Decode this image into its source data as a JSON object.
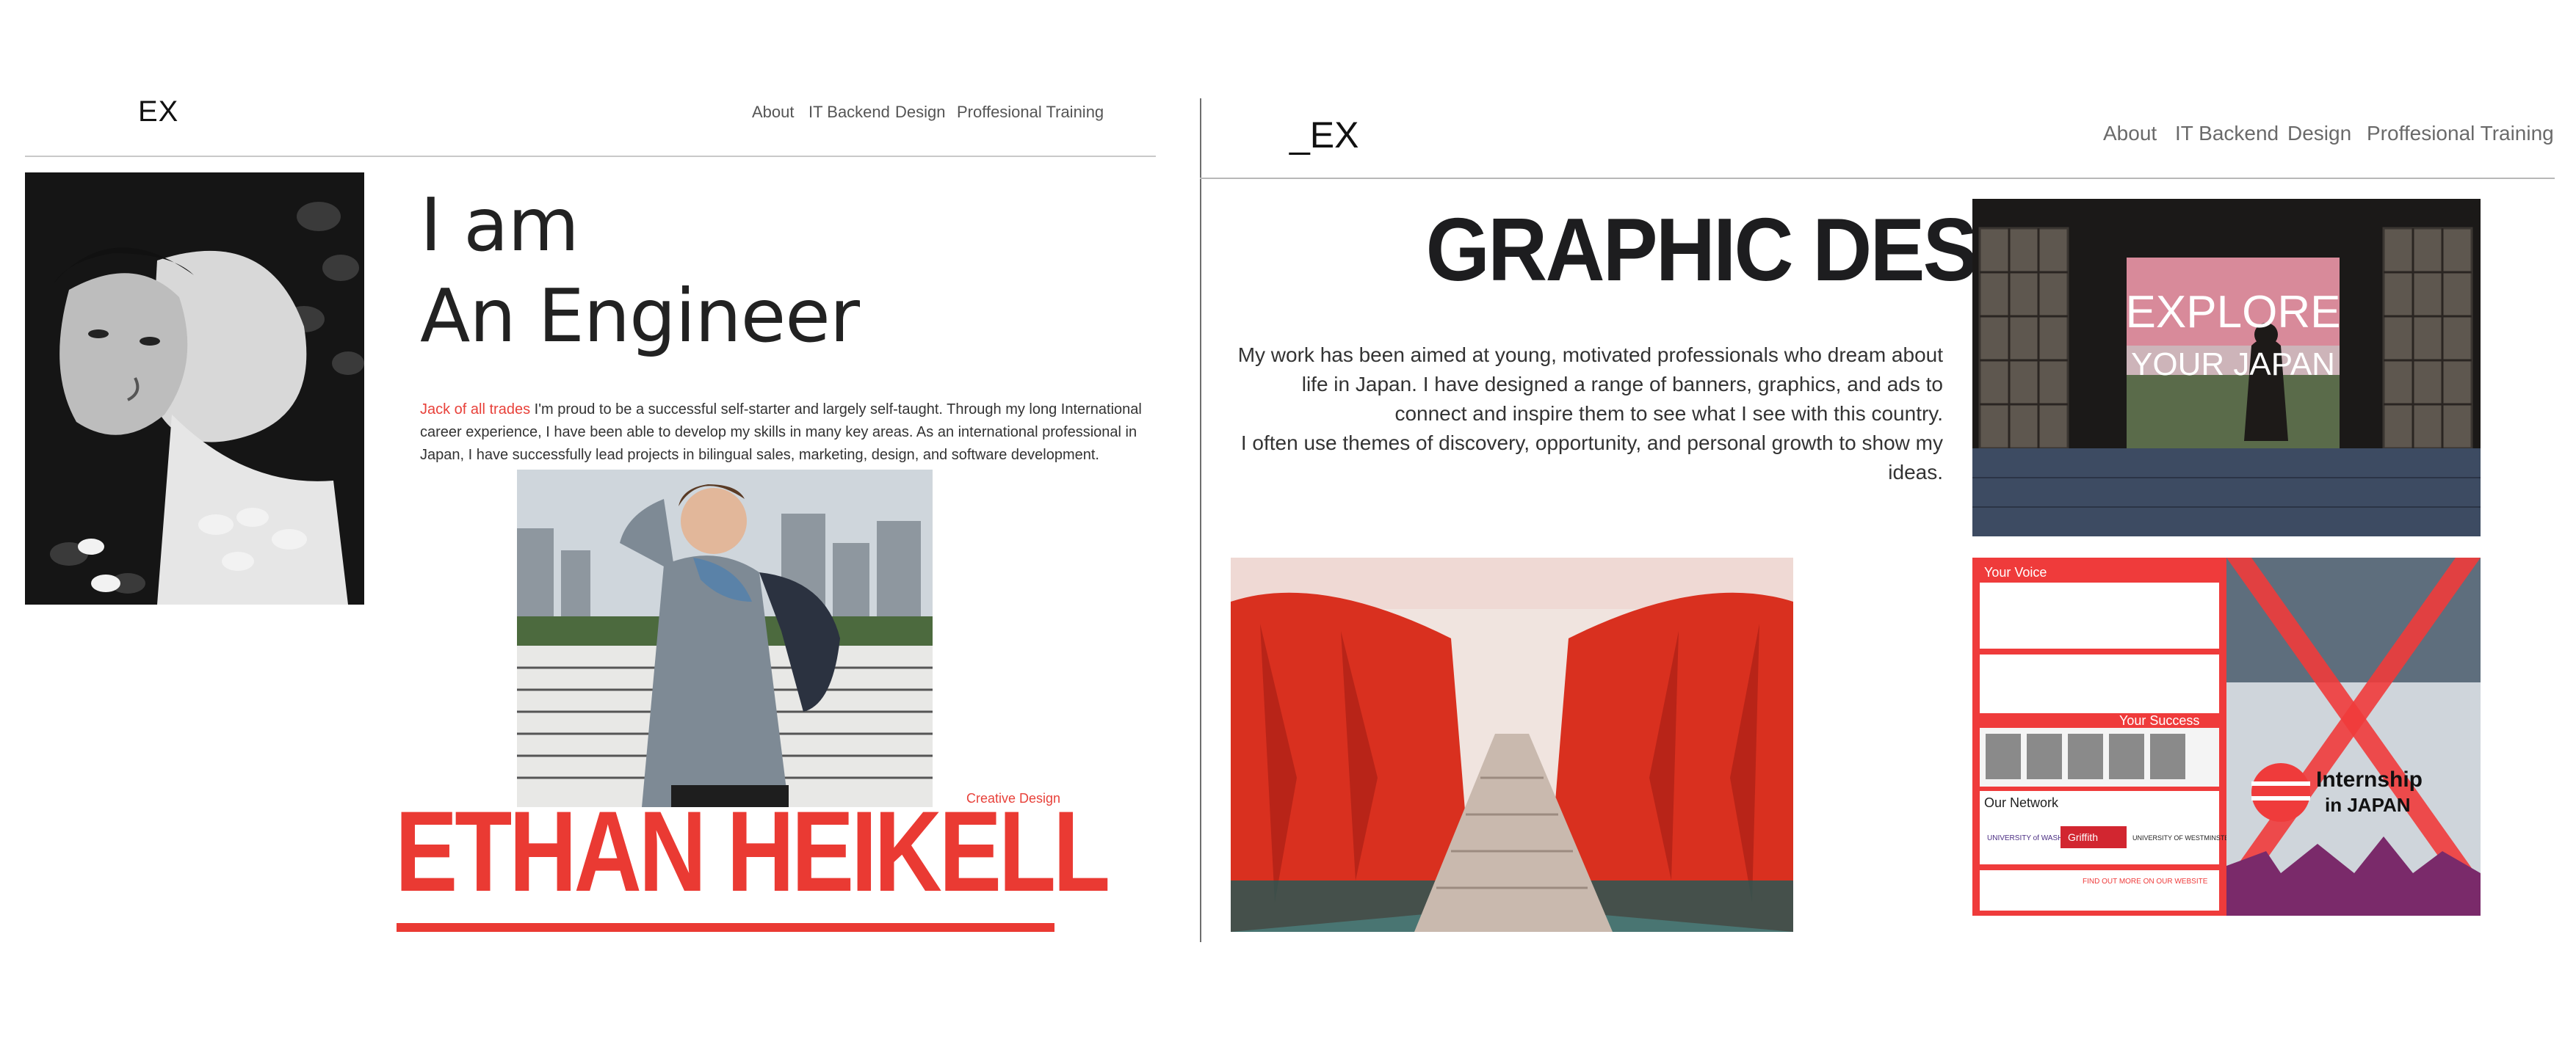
{
  "left": {
    "logo": "EX",
    "nav": [
      "About",
      "IT Backend",
      "Design",
      "Proffesional Training"
    ],
    "headline_line1": "I am",
    "headline_line2": "An Engineer",
    "intro_accent": "Jack of all trades",
    "intro_body": " I'm proud to be a successful self-starter and largely self-taught. Through my long International career experience, I have been able to develop my skills in many key areas. As an international professional in Japan, I have successfully lead projects in bilingual sales, marketing, design, and software development.",
    "creative_label": "Creative Design",
    "name": "ETHAN HEIKELL"
  },
  "right": {
    "logo": "_EX",
    "nav": [
      "About",
      "IT Backend",
      "Design",
      "Proffesional Training"
    ],
    "title": "GRAPHIC DESIGN",
    "description_line1": "My work has been aimed at young, motivated professionals who dream about life in Japan. I have designed a range of banners, graphics, and ads to connect and inspire them to see what I see with this country.",
    "description_line2": "I often use themes of discovery, opportunity, and personal growth to show my ideas.",
    "japan_image_text_1": "EXPLORE",
    "japan_image_text_2": "YOUR JAPAN",
    "poster": {
      "your_voice": "Your Voice",
      "your_success": "Your Success",
      "our_network": "Our Network",
      "brand_line1": "Internship",
      "brand_line2": "in JAPAN",
      "university_1": "UNIVERSITY of WASHINGTON",
      "university_2": "Griffith",
      "university_3": "UNIVERSITY OF WESTMINSTER",
      "cta": "FIND OUT MORE ON OUR WEBSITE"
    }
  },
  "colors": {
    "accent": "#ea3a33",
    "text_dark": "#1d1d1f",
    "divider": "#c9c9c9"
  }
}
